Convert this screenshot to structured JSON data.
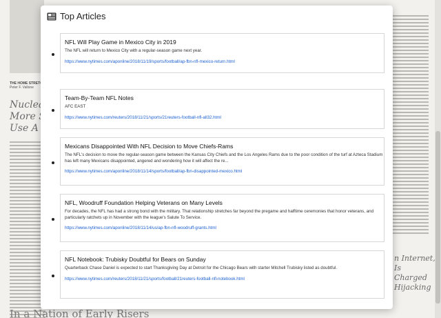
{
  "background": {
    "kicker": "THE HOME STRETCH",
    "byline": "Peter F. Vallone",
    "left_headline": "Nuclear More S Use A",
    "right_headline": "n Internet, Is Charged Hijacking",
    "bottom_headline": "In a Nation of Early Risers"
  },
  "popup": {
    "icon": "newspaper-icon",
    "title": "Top Articles"
  },
  "articles": [
    {
      "title": "NFL Will Play Game in Mexico City in 2019",
      "description": "The NFL will return to Mexico City with a regular-season game next year.",
      "url": "https://www.nytimes.com/aponline/2018/11/19/sports/football/ap-fbn-nfl-mexico-return.html"
    },
    {
      "title": "Team-By-Team NFL Notes",
      "description": "AFC EAST",
      "url": "https://www.nytimes.com/reuters/2018/11/21/sports/21reuters-football-nfl-all32.html"
    },
    {
      "title": "Mexicans Disappointed With NFL Decision to Move Chiefs-Rams",
      "description": "The NFL's decision to move the regular-season game between the Kansas City Chiefs and the Los Angeles Rams due to the poor condition of the turf at Azteca Stadium has left many Mexicans disappointed, angered and wondering how it will affect the re...",
      "url": "https://www.nytimes.com/aponline/2018/11/14/sports/football/ap-fbn-disappointed-mexico.html"
    },
    {
      "title": "NFL, Woodruff Foundation Helping Veterans on Many Levels",
      "description": "For decades, the NFL has had a strong bond with the military. That relationship stretches far beyond the pregame and halftime ceremonies that honor veterans, and particularly ratchets up in November with the league's Salute To Service.",
      "url": "https://www.nytimes.com/aponline/2018/11/14/us/ap-fbn-nfl-woodruff-grants.html"
    },
    {
      "title": "NFL Notebook: Trubisky Doubtful for Bears on Sunday",
      "description": "Quarterback Chase Daniel is expected to start Thanksgiving Day at Detroit for the Chicago Bears with starter Mitchell Trubisky listed as doubtful.",
      "url": "https://www.nytimes.com/reuters/2018/11/21/sports/football/21reuters-football-nfl-notebook.html"
    }
  ]
}
